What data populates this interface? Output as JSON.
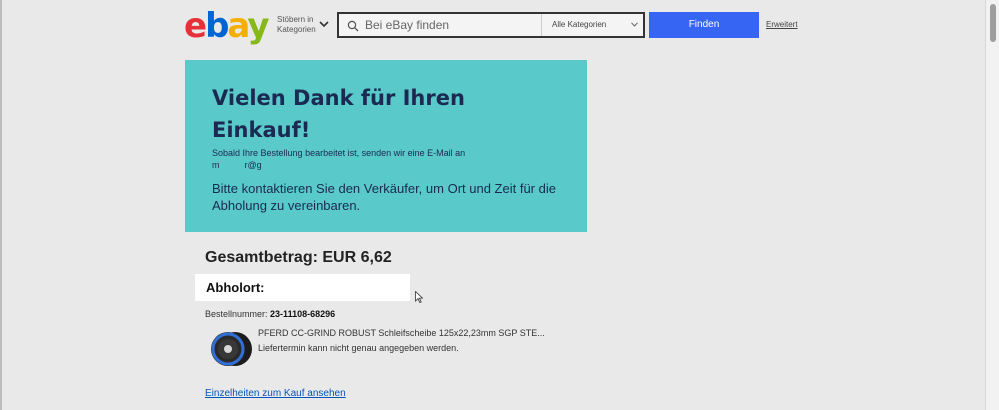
{
  "header": {
    "logo_letters": [
      "e",
      "b",
      "a",
      "y"
    ],
    "browse_line1": "Stöbern in",
    "browse_line2": "Kategorien",
    "search_placeholder": "Bei eBay finden",
    "category_select": "Alle Kategorien",
    "find_button": "Finden",
    "advanced_link": "Erweitert"
  },
  "banner": {
    "title": "Vielen Dank für Ihren Einkauf!",
    "email_notice": "Sobald Ihre Bestellung bearbeitet ist, senden wir eine E-Mail an",
    "email_masked": "m          r@g",
    "contact_notice": "Bitte kontaktieren Sie den Verkäufer, um Ort und Zeit für die Abholung zu vereinbaren.",
    "background_color": "#5ac9c9"
  },
  "order": {
    "total": "Gesamtbetrag: EUR 6,62",
    "pickup_label": "Abholort:",
    "order_number_label": "Bestellnummer:",
    "order_number": "23-11108-68296",
    "product_title": "PFERD CC-GRIND ROBUST Schleifscheibe 125x22,23mm SGP STE...",
    "delivery_note": "Liefertermin kann nicht genau angegeben werden.",
    "details_link": "Einzelheiten zum Kauf ansehen"
  },
  "colors": {
    "accent": "#3665f3",
    "link": "#0654ba"
  }
}
